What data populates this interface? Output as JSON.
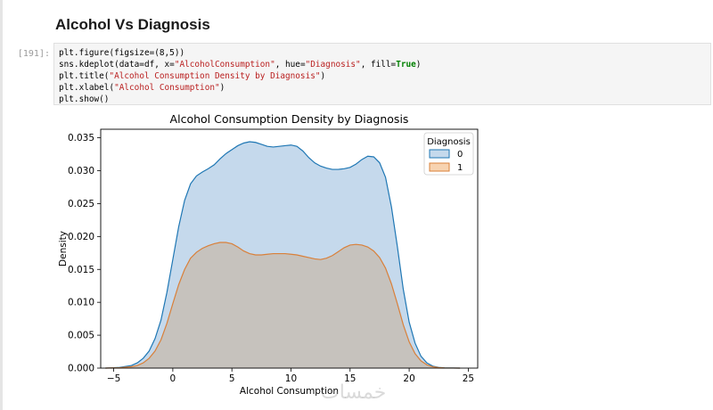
{
  "notebook": {
    "heading": "Alcohol Vs Diagnosis",
    "prompt": "[191]:",
    "code": [
      [
        {
          "t": "plt.figure(figsize=(8,5))"
        }
      ],
      [
        {
          "t": "sns.kdeplot(data=df, x="
        },
        {
          "t": "\"AlcoholConsumption\"",
          "c": "tok-str"
        },
        {
          "t": ", hue="
        },
        {
          "t": "\"Diagnosis\"",
          "c": "tok-str"
        },
        {
          "t": ", fill="
        },
        {
          "t": "True",
          "c": "tok-kw"
        },
        {
          "t": ")"
        }
      ],
      [
        {
          "t": "plt.title("
        },
        {
          "t": "\"Alcohol Consumption Density by Diagnosis\"",
          "c": "tok-str"
        },
        {
          "t": ")"
        }
      ],
      [
        {
          "t": "plt.xlabel("
        },
        {
          "t": "\"Alcohol Consumption\"",
          "c": "tok-str"
        },
        {
          "t": ")"
        }
      ],
      [
        {
          "t": "plt.show()"
        }
      ]
    ],
    "watermark": "خمسات"
  },
  "colors": {
    "series0_line": "#1f77b4",
    "series0_fill": "#c5d9ec",
    "series1_line": "#d9803a",
    "series1_fill": "#c6c2bd"
  },
  "chart_data": {
    "type": "area",
    "title": "Alcohol Consumption Density by Diagnosis",
    "xlabel": "Alcohol Consumption",
    "ylabel": "Density",
    "xlim": [
      -6.1,
      25.8
    ],
    "ylim": [
      0,
      0.0363
    ],
    "xticks": [
      -5,
      0,
      5,
      10,
      15,
      20,
      25
    ],
    "yticks": [
      0.0,
      0.005,
      0.01,
      0.015,
      0.02,
      0.025,
      0.03,
      0.035
    ],
    "ytick_labels": [
      "0.000",
      "0.005",
      "0.010",
      "0.015",
      "0.020",
      "0.025",
      "0.030",
      "0.035"
    ],
    "legend": {
      "title": "Diagnosis",
      "position": "top-right",
      "entries": [
        "0",
        "1"
      ]
    },
    "grid": false,
    "series": [
      {
        "name": "0",
        "x": [
          -5.7,
          -4.5,
          -3.5,
          -3,
          -2.5,
          -2,
          -1.5,
          -1,
          -0.5,
          0,
          0.5,
          1,
          1.5,
          2,
          2.5,
          3,
          3.5,
          4,
          4.5,
          5,
          5.5,
          6,
          6.5,
          7,
          7.5,
          8,
          8.5,
          9,
          9.5,
          10,
          10.5,
          11,
          11.5,
          12,
          12.5,
          13,
          13.5,
          14,
          14.5,
          15,
          15.5,
          16,
          16.5,
          17,
          17.5,
          18,
          18.5,
          19,
          19.5,
          20,
          20.5,
          21,
          21.5,
          22,
          22.5,
          23,
          24.3
        ],
        "y": [
          0,
          0.0001,
          0.0004,
          0.0008,
          0.0015,
          0.0026,
          0.0045,
          0.0073,
          0.0115,
          0.0165,
          0.0215,
          0.0255,
          0.028,
          0.0292,
          0.0298,
          0.0303,
          0.0309,
          0.0318,
          0.0326,
          0.0332,
          0.0338,
          0.0342,
          0.0344,
          0.0343,
          0.034,
          0.0337,
          0.0336,
          0.0337,
          0.0338,
          0.0339,
          0.0337,
          0.033,
          0.032,
          0.0312,
          0.0307,
          0.0304,
          0.0302,
          0.0302,
          0.0303,
          0.0305,
          0.031,
          0.0317,
          0.0322,
          0.0321,
          0.0312,
          0.029,
          0.0245,
          0.0185,
          0.012,
          0.007,
          0.0038,
          0.0018,
          0.0008,
          0.0003,
          0.0001,
          4e-05,
          0
        ]
      },
      {
        "name": "1",
        "x": [
          -5.7,
          -4.5,
          -3.5,
          -3,
          -2.5,
          -2,
          -1.5,
          -1,
          -0.5,
          0,
          0.5,
          1,
          1.5,
          2,
          2.5,
          3,
          3.5,
          4,
          4.5,
          5,
          5.5,
          6,
          6.5,
          7,
          7.5,
          8,
          8.5,
          9,
          9.5,
          10,
          10.5,
          11,
          11.5,
          12,
          12.5,
          13,
          13.5,
          14,
          14.5,
          15,
          15.5,
          16,
          16.5,
          17,
          17.5,
          18,
          18.5,
          19,
          19.5,
          20,
          20.5,
          21,
          21.5,
          22,
          22.5,
          23,
          24.3
        ],
        "y": [
          0,
          5e-05,
          0.0002,
          0.0004,
          0.0008,
          0.0015,
          0.0026,
          0.0043,
          0.0068,
          0.0098,
          0.0127,
          0.015,
          0.0167,
          0.0176,
          0.0182,
          0.0186,
          0.0189,
          0.0191,
          0.0191,
          0.0189,
          0.0184,
          0.0178,
          0.0174,
          0.0172,
          0.0172,
          0.0173,
          0.0174,
          0.0174,
          0.0174,
          0.0173,
          0.0172,
          0.017,
          0.0168,
          0.0166,
          0.0165,
          0.0167,
          0.0171,
          0.0177,
          0.0183,
          0.0187,
          0.0188,
          0.0187,
          0.0184,
          0.0178,
          0.0168,
          0.0152,
          0.0128,
          0.0098,
          0.0066,
          0.004,
          0.0022,
          0.0011,
          0.0005,
          0.0002,
          7e-05,
          2e-05,
          0
        ]
      }
    ]
  }
}
